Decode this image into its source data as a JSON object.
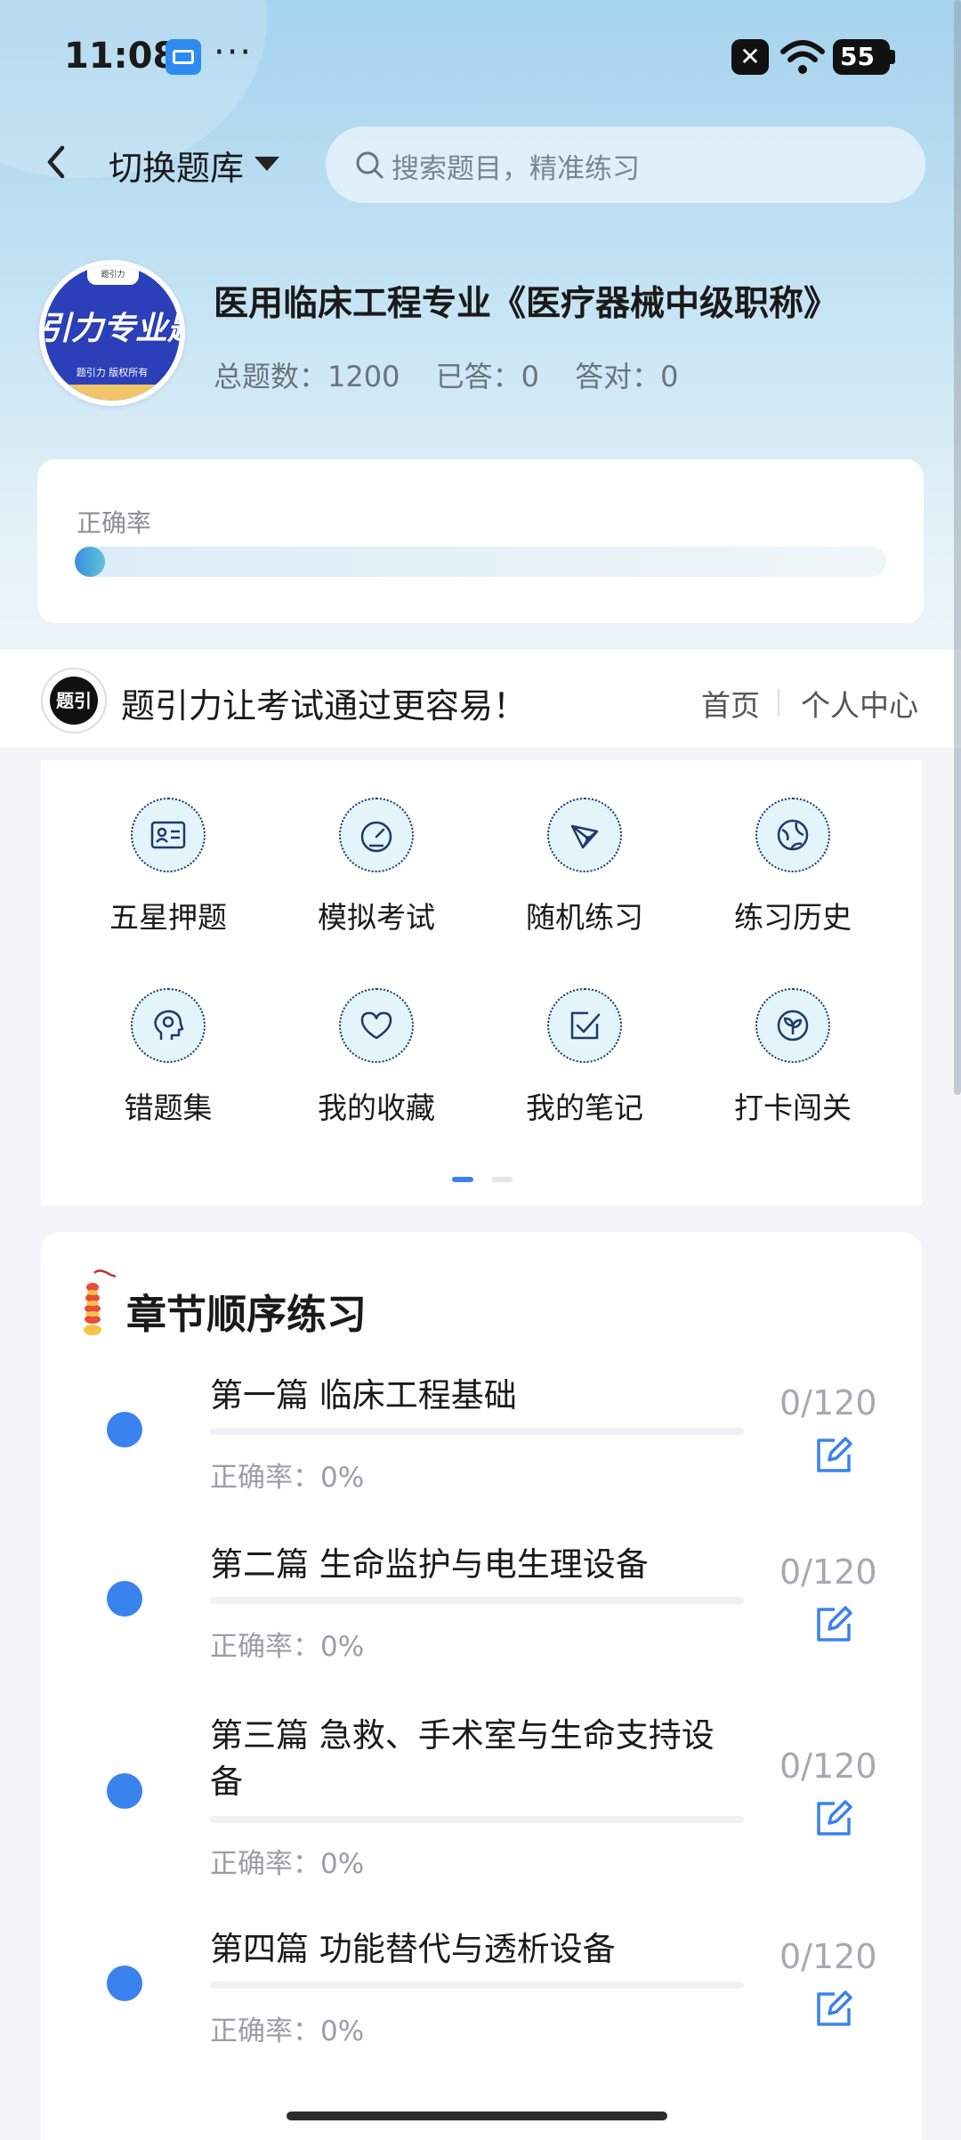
{
  "status_bar": {
    "time": "11:08",
    "more": "···",
    "battery": "55"
  },
  "header": {
    "switch_label": "切换题库",
    "search_placeholder": "搜索题目，精准练习"
  },
  "book": {
    "logo_text": "引力专业题",
    "logo_tab": "题引力",
    "logo_sub": "题引力 版权所有",
    "title": "医用临床工程专业《医疗器械中级职称》",
    "total_label": "总题数：1200",
    "answered_label": "已答：0",
    "correct_label": "答对：0"
  },
  "accuracy": {
    "label": "正确率",
    "value_fraction": 0.0
  },
  "brand": {
    "logo_text": "题引力",
    "slogan": "题引力让考试通过更容易！",
    "home": "首页",
    "profile": "个人中心"
  },
  "menu": {
    "items": [
      {
        "label": "五星押题",
        "icon": "id-card-icon"
      },
      {
        "label": "模拟考试",
        "icon": "gauge-icon"
      },
      {
        "label": "随机练习",
        "icon": "network-icon"
      },
      {
        "label": "练习历史",
        "icon": "globe-icon"
      },
      {
        "label": "错题集",
        "icon": "head-icon"
      },
      {
        "label": "我的收藏",
        "icon": "heart-icon"
      },
      {
        "label": "我的笔记",
        "icon": "checkbox-icon"
      },
      {
        "label": "打卡闯关",
        "icon": "sprout-icon"
      }
    ],
    "page_count": 2,
    "active_page": 1
  },
  "chapters": {
    "title": "章节顺序练习",
    "items": [
      {
        "name": "第一篇 临床工程基础",
        "accuracy": "正确率：0%",
        "count": "0/120",
        "progress": 0
      },
      {
        "name": "第二篇 生命监护与电生理设备",
        "accuracy": "正确率：0%",
        "count": "0/120",
        "progress": 0
      },
      {
        "name": "第三篇 急救、手术室与生命支持设备",
        "accuracy": "正确率：0%",
        "count": "0/120",
        "progress": 0
      },
      {
        "name": "第四篇 功能替代与透析设备",
        "accuracy": "正确率：0%",
        "count": "0/120",
        "progress": 0
      }
    ]
  },
  "colors": {
    "accent": "#3a82ee",
    "icon_bg": "#e3f4fb",
    "icon_stroke": "#1e3a6a"
  }
}
